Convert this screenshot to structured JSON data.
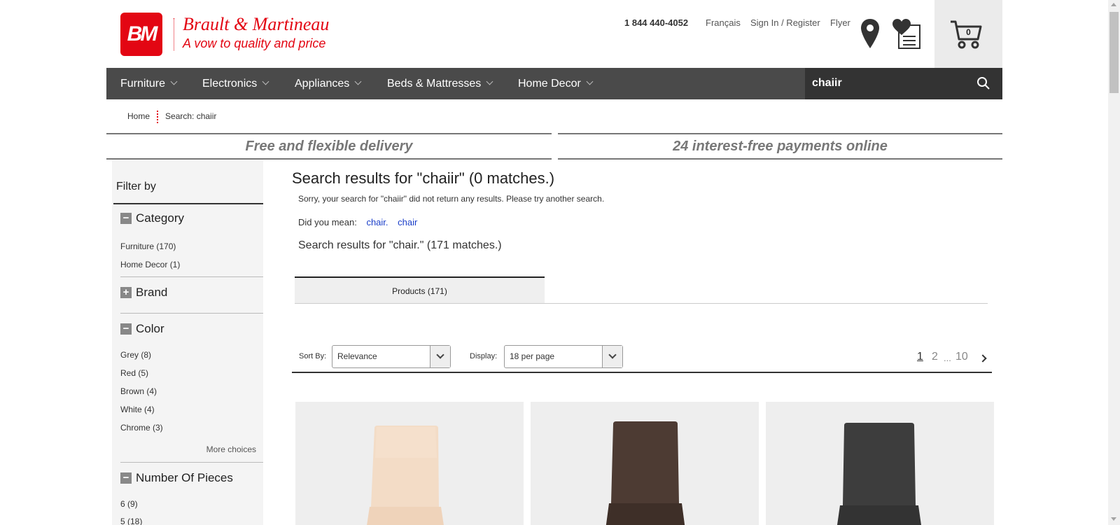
{
  "header": {
    "logo_mark": "BM",
    "brand_name": "Brault & Martineau",
    "tagline": "A vow to quality and price",
    "phone": "1 844 440-4052",
    "lang_link": "Français",
    "signin_link": "Sign In / Register",
    "flyer_link": "Flyer",
    "cart_count": "0"
  },
  "nav": {
    "items": [
      "Furniture",
      "Electronics",
      "Appliances",
      "Beds & Mattresses",
      "Home Decor"
    ],
    "search_value": "chaiir"
  },
  "breadcrumb": {
    "home": "Home",
    "current": "Search: chaiir"
  },
  "promos": [
    "Free and flexible delivery",
    "24 interest-free payments online"
  ],
  "sidebar": {
    "title": "Filter by",
    "category": {
      "label": "Category",
      "items": [
        "Furniture (170)",
        "Home Decor (1)"
      ]
    },
    "brand": {
      "label": "Brand"
    },
    "color": {
      "label": "Color",
      "items": [
        "Grey (8)",
        "Red (5)",
        "Brown (4)",
        "White (4)",
        "Chrome (3)"
      ],
      "more": "More choices"
    },
    "pieces": {
      "label": "Number Of Pieces",
      "items": [
        "6 (9)",
        "5 (18)"
      ]
    }
  },
  "results": {
    "title": "Search results for \"chaiir\" (0 matches.)",
    "sorry": "Sorry, your search for \"chaiir\" did not return any results. Please try another search.",
    "did_you_mean": "Did you mean:",
    "suggestions": [
      "chair.",
      "chair"
    ],
    "alt_title": "Search results for \"chair.\" (171 matches.)",
    "tab": "Products (171)"
  },
  "toolbar": {
    "sort_label": "Sort By:",
    "sort_value": "Relevance",
    "display_label": "Display:",
    "display_value": "18 per page",
    "pages": [
      "1",
      "2",
      "...",
      "10"
    ]
  },
  "products": [
    {
      "image": "beige-dining-chair",
      "color": "#f0d9c2"
    },
    {
      "image": "brown-dining-chair",
      "color": "#4a3a32"
    },
    {
      "image": "charcoal-dining-chair",
      "color": "#3a3a3a"
    }
  ]
}
